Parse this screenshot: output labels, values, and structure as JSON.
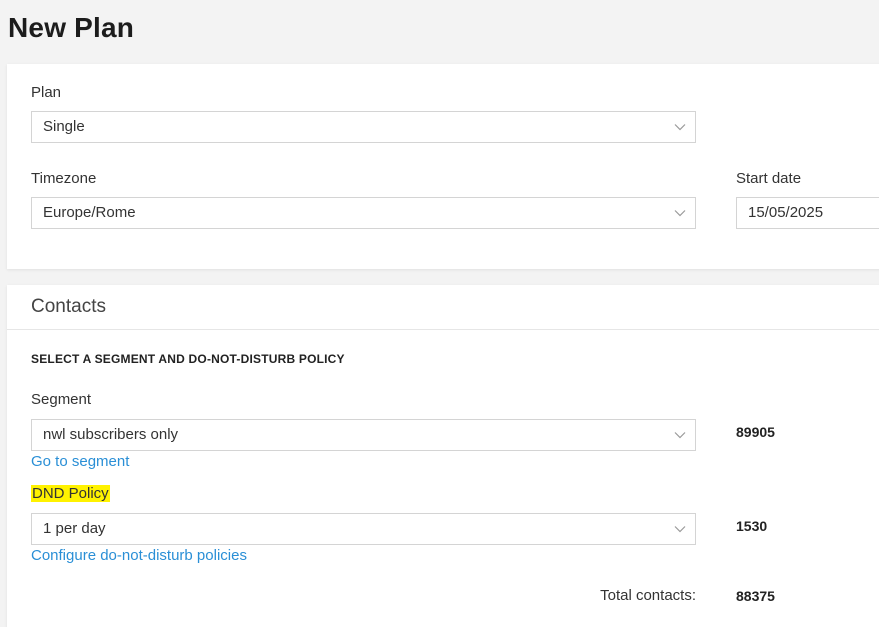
{
  "page": {
    "title": "New Plan"
  },
  "plan_card": {
    "plan_label": "Plan",
    "plan_value": "Single",
    "timezone_label": "Timezone",
    "timezone_value": "Europe/Rome",
    "start_date_label": "Start date",
    "start_date_value": "15/05/2025"
  },
  "contacts": {
    "title": "Contacts",
    "section_heading": "SELECT A SEGMENT AND DO-NOT-DISTURB POLICY",
    "segment_label": "Segment",
    "segment_value": "nwl subscribers only",
    "segment_count": "89905",
    "segment_link": "Go to segment",
    "dnd_label": "DND Policy",
    "dnd_value": "1 per day",
    "dnd_count": "1530",
    "dnd_link": "Configure do-not-disturb policies",
    "total_label": "Total contacts:",
    "total_value": "88375"
  },
  "icons": {
    "dropdown": "chevron-down-icon"
  },
  "colors": {
    "link": "#2a8fd6",
    "highlight": "#fff200",
    "border": "#d4d4d4"
  }
}
